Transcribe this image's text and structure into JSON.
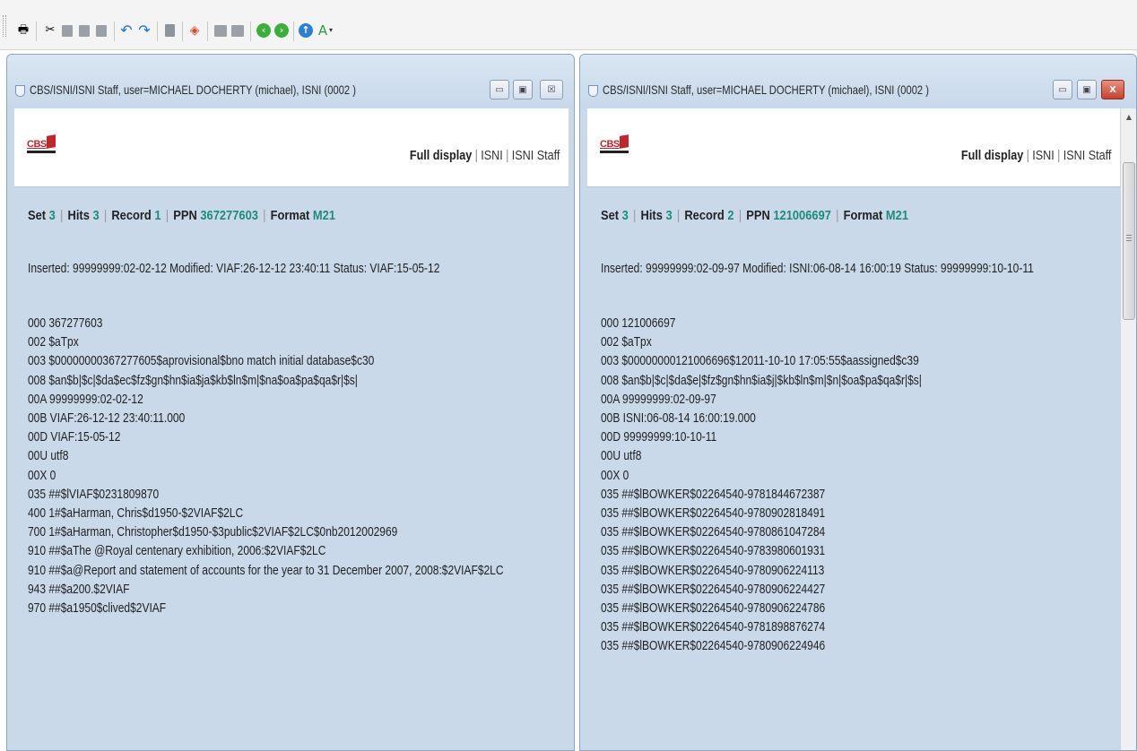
{
  "toolbar": {
    "icons": [
      "printer-icon",
      "cut-icon",
      "copy-icon",
      "paste-icon",
      "clipboard-icon",
      "undo-icon",
      "redo-icon",
      "page-icon",
      "color-picker-icon",
      "view-left-icon",
      "view-right-icon",
      "back-icon",
      "forward-icon",
      "up-icon",
      "format-icon"
    ]
  },
  "left": {
    "title": "CBS/ISNI/ISNI Staff, user=MICHAEL DOCHERTY (michael), ISNI (0002 )",
    "logo": "CBS",
    "nav": {
      "full_display": "Full display",
      "isni": "ISNI",
      "isni_staff": "ISNI Staff"
    },
    "meta": {
      "set_label": "Set",
      "set": "3",
      "hits_label": "Hits",
      "hits": "3",
      "record_label": "Record",
      "record": "1",
      "ppn_label": "PPN",
      "ppn": "367277603",
      "format_label": "Format",
      "format": "M21"
    },
    "inserted": "Inserted: 99999999:02-02-12 Modified: VIAF:26-12-12 23:40:11 Status: VIAF:15-05-12",
    "lines": [
      "000 367277603",
      "002 $aTpx",
      "003 $00000000367277605$aprovisional$bno match initial database$c30",
      "008 $an$b|$c|$da$ec$fz$gn$hn$ia$ja$kb$ln$m|$na$oa$pa$qa$r|$s|",
      "00A 99999999:02-02-12",
      "00B VIAF:26-12-12 23:40:11.000",
      "00D VIAF:15-05-12",
      "00U utf8",
      "00X 0",
      "035 ##$lVIAF$0231809870",
      "400 1#$aHarman, Chris$d1950-$2VIAF$2LC",
      "700 1#$aHarman, Christopher$d1950-$3public$2VIAF$2LC$0nb2012002969",
      "910 ##$aThe @Royal centenary exhibition, 2006:$2VIAF$2LC",
      "910 ##$a@Report and statement of accounts for the year to 31 December 2007, 2008:$2VIAF$2LC",
      "943 ##$a200.$2VIAF",
      "970 ##$a1950$clived$2VIAF"
    ]
  },
  "right": {
    "title": "CBS/ISNI/ISNI Staff, user=MICHAEL DOCHERTY (michael), ISNI (0002 )",
    "logo": "CBS",
    "nav": {
      "full_display": "Full display",
      "isni": "ISNI",
      "isni_staff": "ISNI Staff"
    },
    "meta": {
      "set_label": "Set",
      "set": "3",
      "hits_label": "Hits",
      "hits": "3",
      "record_label": "Record",
      "record": "2",
      "ppn_label": "PPN",
      "ppn": "121006697",
      "format_label": "Format",
      "format": "M21"
    },
    "inserted": "Inserted: 99999999:02-09-97 Modified: ISNI:06-08-14 16:00:19 Status: 99999999:10-10-11",
    "lines": [
      "000 121006697",
      "002 $aTpx",
      "003 $00000000121006696$12011-10-10 17:05:55$aassigned$c39",
      "008 $an$b|$c|$da$e|$fz$gn$hn$ia$j|$kb$ln$m|$n|$oa$pa$qa$r|$s|",
      "00A 99999999:02-09-97",
      "00B ISNI:06-08-14 16:00:19.000",
      "00D 99999999:10-10-11",
      "00U utf8",
      "00X 0",
      "035 ##$lBOWKER$02264540-9781844672387",
      "035 ##$lBOWKER$02264540-9780902818491",
      "035 ##$lBOWKER$02264540-9780861047284",
      "035 ##$lBOWKER$02264540-9783980601931",
      "035 ##$lBOWKER$02264540-9780906224113",
      "035 ##$lBOWKER$02264540-9780906224427",
      "035 ##$lBOWKER$02264540-9780906224786",
      "035 ##$lBOWKER$02264540-9781898876274",
      "035 ##$lBOWKER$02264540-9780906224946"
    ]
  },
  "window_buttons": {
    "minimize": "▭",
    "restore": "▣",
    "close_left": "☒",
    "close_right": "X"
  }
}
